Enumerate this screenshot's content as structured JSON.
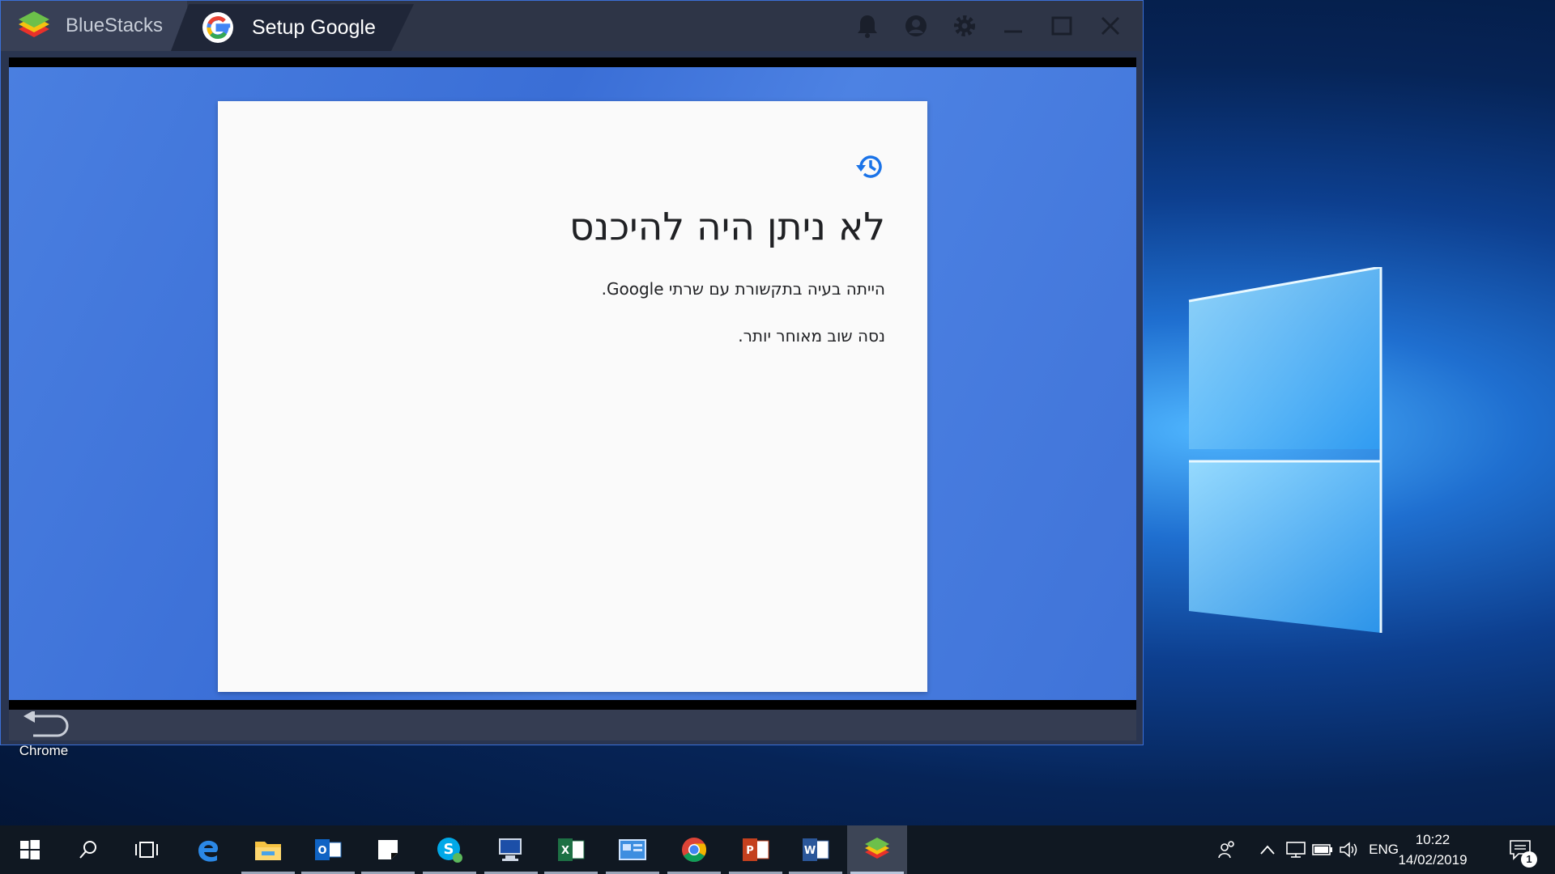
{
  "bluestacks": {
    "home_tab_label": "BlueStacks",
    "app_tab_label": "Setup Google",
    "title_controls": [
      "notification-bell",
      "account",
      "settings",
      "minimize",
      "maximize",
      "close"
    ]
  },
  "google_page": {
    "title": "לא ניתן היה להיכנס",
    "line1": "הייתה בעיה בתקשורת עם שרתי Google.",
    "line2": "נסה שוב מאוחר יותר."
  },
  "desktop": {
    "icon_label": "Chrome"
  },
  "taskbar": {
    "apps": [
      "start",
      "search",
      "task-view",
      "edge",
      "file-explorer",
      "outlook",
      "sticky-notes",
      "skype",
      "remote-desktop",
      "excel",
      "control-panel",
      "chrome",
      "powerpoint",
      "word",
      "bluestacks"
    ],
    "language": "ENG",
    "time": "10:22",
    "date": "14/02/2019",
    "notification_count": "1"
  },
  "colors": {
    "android_bg": "#3f73d8",
    "titlebar": "#2e3547",
    "taskbar": "#101822",
    "accent_blue": "#1a73e8"
  }
}
